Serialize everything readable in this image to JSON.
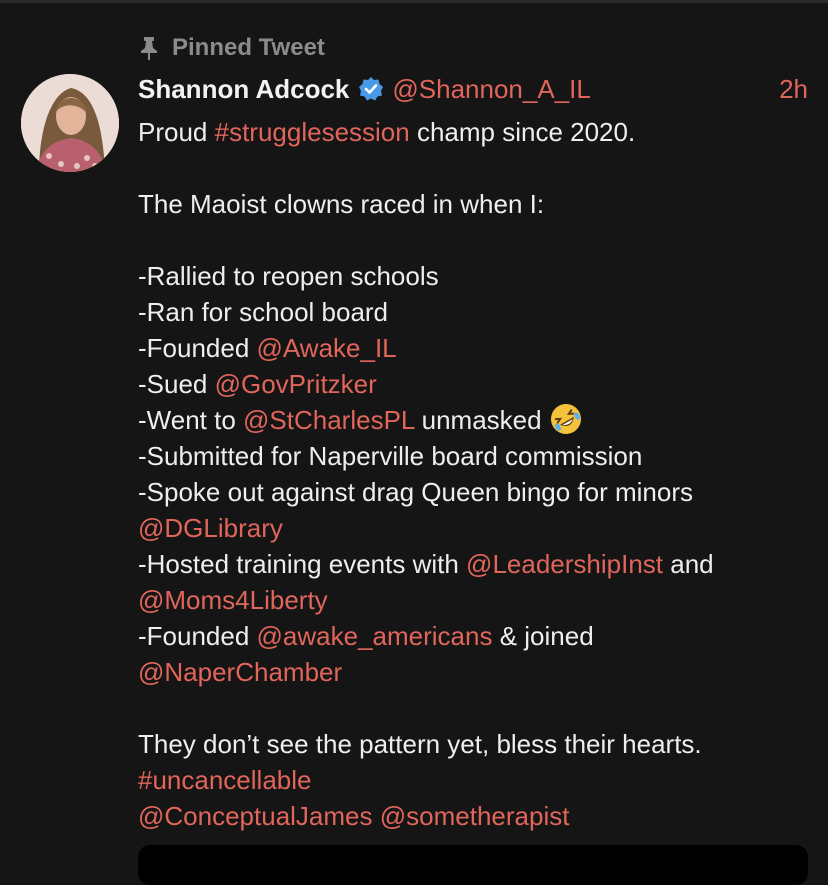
{
  "pinned_label": "Pinned Tweet",
  "author": {
    "name": "Shannon Adcock",
    "handle": "@Shannon_A_IL",
    "time": "2h",
    "verified": true
  },
  "tweet": {
    "l1_a": "Proud ",
    "l1_tag": "#strugglesession",
    "l1_b": " champ since 2020.",
    "l2": "The Maoist clowns raced in when I:",
    "l3": "-Rallied to reopen schools",
    "l4": "-Ran for school board",
    "l5_a": "-Founded ",
    "l5_m": "@Awake_IL",
    "l6_a": "-Sued ",
    "l6_m": "@GovPritzker",
    "l7_a": "-Went to ",
    "l7_m": "@StCharlesPL",
    "l7_b": " unmasked ",
    "l8": "-Submitted for Naperville board commission",
    "l9": "-Spoke out against drag Queen bingo for minors",
    "l10_m": "@DGLibrary",
    "l11_a": "-Hosted training events with ",
    "l11_m": "@LeadershipInst",
    "l11_b": " and",
    "l12_m": "@Moms4Liberty",
    "l13_a": "-Founded ",
    "l13_m": "@awake_americans",
    "l13_b": " & joined",
    "l14_m": "@NaperChamber",
    "l15": "They don’t see the pattern yet, bless their hearts.",
    "l16_tag": "#uncancellable",
    "l17_m1": "@ConceptualJames",
    "l17_sp": " ",
    "l17_m2": "@sometherapist"
  },
  "colors": {
    "background": "#151515",
    "text": "#eeeeee",
    "accent_link": "#e0655a",
    "muted": "#8b8b8b",
    "verified_badge": "#4a99e9"
  },
  "icons": {
    "pin": "pin-icon",
    "verified": "verified-badge-icon",
    "emoji": "rolling-on-floor-laughing-emoji"
  }
}
